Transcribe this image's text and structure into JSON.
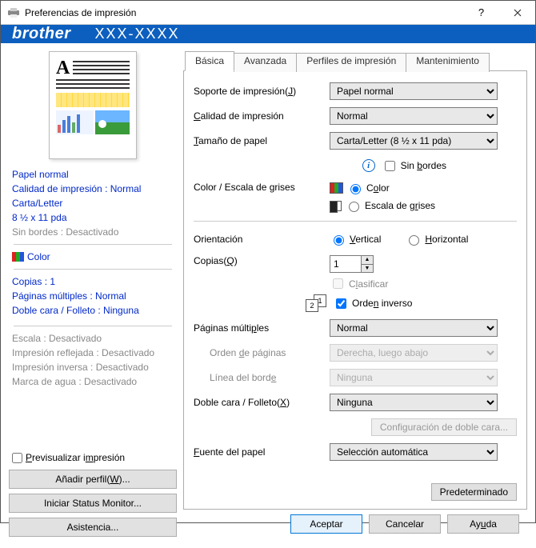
{
  "window": {
    "title": "Preferencias de impresión"
  },
  "brand": {
    "logo": "brother",
    "model": "XXX-XXXX"
  },
  "sidebar": {
    "info_blue": [
      "Papel normal",
      "Calidad de impresión : Normal",
      "Carta/Letter",
      "8 ½ x 11 pda",
      "Sin bordes : Desactivado"
    ],
    "color_label": "Color",
    "info_blue2": [
      "Copias : 1",
      "Páginas múltiples : Normal",
      "Doble cara / Folleto : Ninguna"
    ],
    "info_gray": [
      "Escala : Desactivado",
      "Impresión reflejada : Desactivado",
      "Impresión inversa : Desactivado",
      "Marca de agua : Desactivado"
    ],
    "preview_checkbox": "Previsualizar impresión",
    "btn_add_profile": "Añadir perfil(W)...",
    "btn_status_monitor": "Iniciar Status Monitor...",
    "btn_support": "Asistencia..."
  },
  "tabs": {
    "basic": "Básica",
    "advanced": "Avanzada",
    "profiles": "Perfiles de impresión",
    "maintenance": "Mantenimiento"
  },
  "form": {
    "media_label": "Soporte de impresión(J)",
    "media_value": "Papel normal",
    "quality_label": "Calidad de impresión",
    "quality_value": "Normal",
    "papersize_label": "Tamaño de papel",
    "papersize_value": "Carta/Letter (8 ½ x 11 pda)",
    "borderless_label": "Sin bordes",
    "colorscale_label": "Color / Escala de grises",
    "color_option": "Color",
    "gray_option": "Escala de grises",
    "orientation_label": "Orientación",
    "orient_v": "Vertical",
    "orient_h": "Horizontal",
    "copies_label": "Copias(Q)",
    "copies_value": "1",
    "collate_label": "Clasificar",
    "reverse_label": "Orden inverso",
    "multipage_label": "Páginas múltiples",
    "multipage_value": "Normal",
    "pageorder_label": "Orden de páginas",
    "pageorder_value": "Derecha, luego abajo",
    "borderline_label": "Línea del borde",
    "borderline_value": "Ninguna",
    "duplex_label": "Doble cara / Folleto(X)",
    "duplex_value": "Ninguna",
    "duplex_config": "Configuración de doble cara...",
    "papersource_label": "Fuente del papel",
    "papersource_value": "Selección automática",
    "default_btn": "Predeterminado"
  },
  "footer": {
    "ok": "Aceptar",
    "cancel": "Cancelar",
    "help": "Ayuda"
  }
}
